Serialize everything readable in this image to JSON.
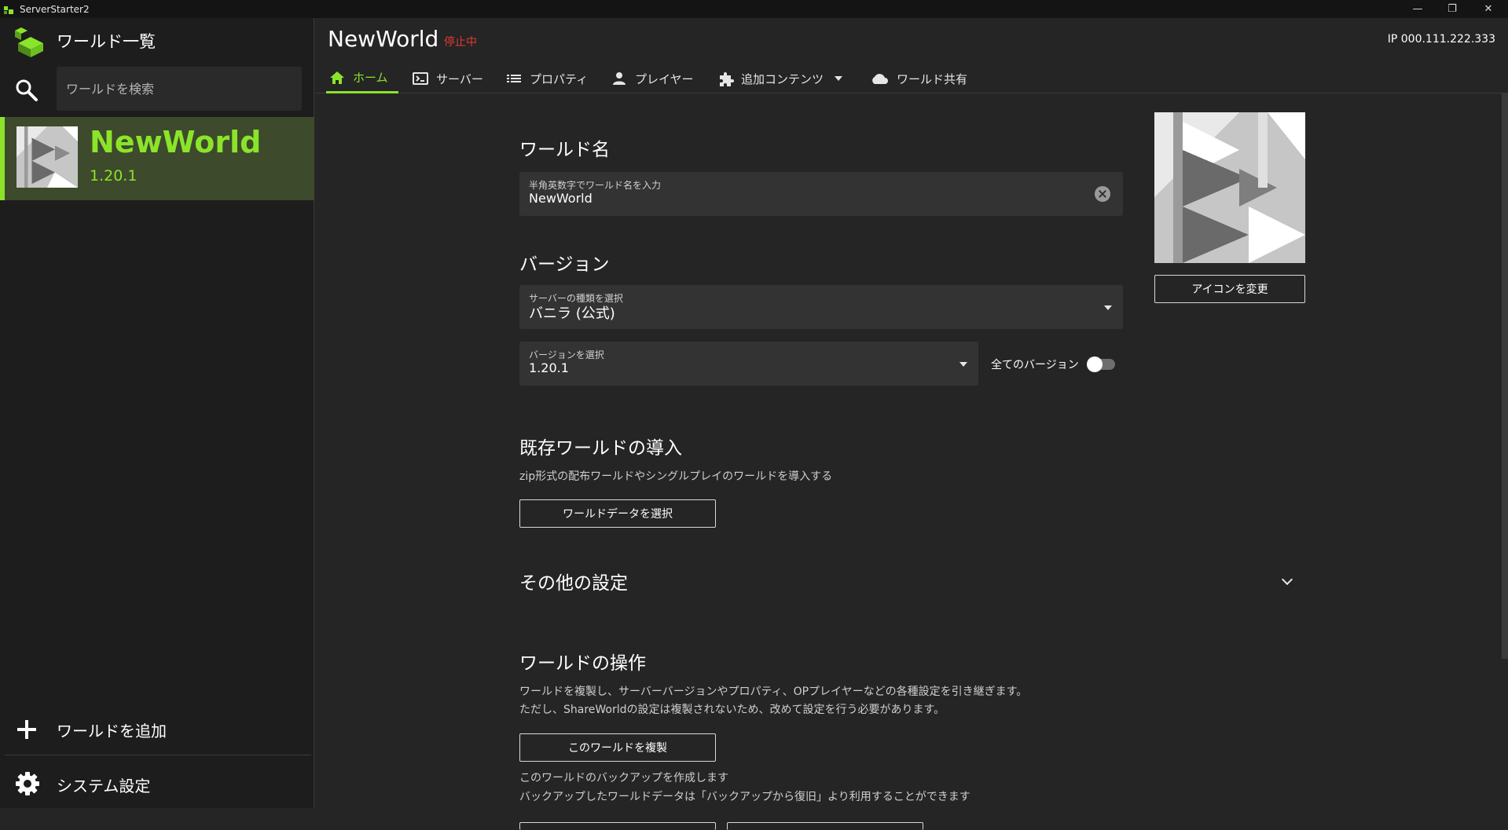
{
  "window": {
    "title": "ServerStarter2",
    "minimize_glyph": "—",
    "maximize_glyph": "❐",
    "close_glyph": "✕"
  },
  "sidebar": {
    "header_title": "ワールド一覧",
    "search_placeholder": "ワールドを検索",
    "worlds": [
      {
        "name": "NewWorld",
        "version": "1.20.1",
        "selected": true
      }
    ],
    "add_world_label": "ワールドを追加",
    "system_settings_label": "システム設定"
  },
  "header": {
    "world_title": "NewWorld",
    "status": "停止中",
    "ip": "IP 000.111.222.333"
  },
  "tabs": [
    {
      "label": "ホーム",
      "icon": "home-icon",
      "active": true
    },
    {
      "label": "サーバー",
      "icon": "console-icon",
      "active": false
    },
    {
      "label": "プロパティ",
      "icon": "list-icon",
      "active": false
    },
    {
      "label": "プレイヤー",
      "icon": "person-icon",
      "active": false
    },
    {
      "label": "追加コンテンツ",
      "icon": "puzzle-icon",
      "active": false
    },
    {
      "label": "ワールド共有",
      "icon": "cloud-icon",
      "active": false
    }
  ],
  "home": {
    "world_name_heading": "ワールド名",
    "world_name_field_label": "半角英数字でワールド名を入力",
    "world_name_value": "NewWorld",
    "version_heading": "バージョン",
    "server_type_label": "サーバーの種類を選択",
    "server_type_value": "バニラ (公式)",
    "version_select_label": "バージョンを選択",
    "version_select_value": "1.20.1",
    "all_versions_label": "全てのバージョン",
    "all_versions_on": false,
    "change_icon_button": "アイコンを変更",
    "import_heading": "既存ワールドの導入",
    "import_desc": "zip形式の配布ワールドやシングルプレイのワールドを導入する",
    "select_world_data_button": "ワールドデータを選択",
    "other_settings_heading": "その他の設定",
    "operations_heading": "ワールドの操作",
    "operations_desc_1": "ワールドを複製し、サーバーバージョンやプロパティ、OPプレイヤーなどの各種設定を引き継ぎます。",
    "operations_desc_2": "ただし、ShareWorldの設定は複製されないため、改めて設定を行う必要があります。",
    "duplicate_button": "このワールドを複製",
    "backup_desc_1": "このワールドのバックアップを作成します",
    "backup_desc_2": "バックアップしたワールドデータは「バックアップから復旧」より利用することができます"
  },
  "colors": {
    "accent": "#8be42a",
    "status_stopped": "#e53935",
    "selected_bg": "#3d4a2c"
  }
}
